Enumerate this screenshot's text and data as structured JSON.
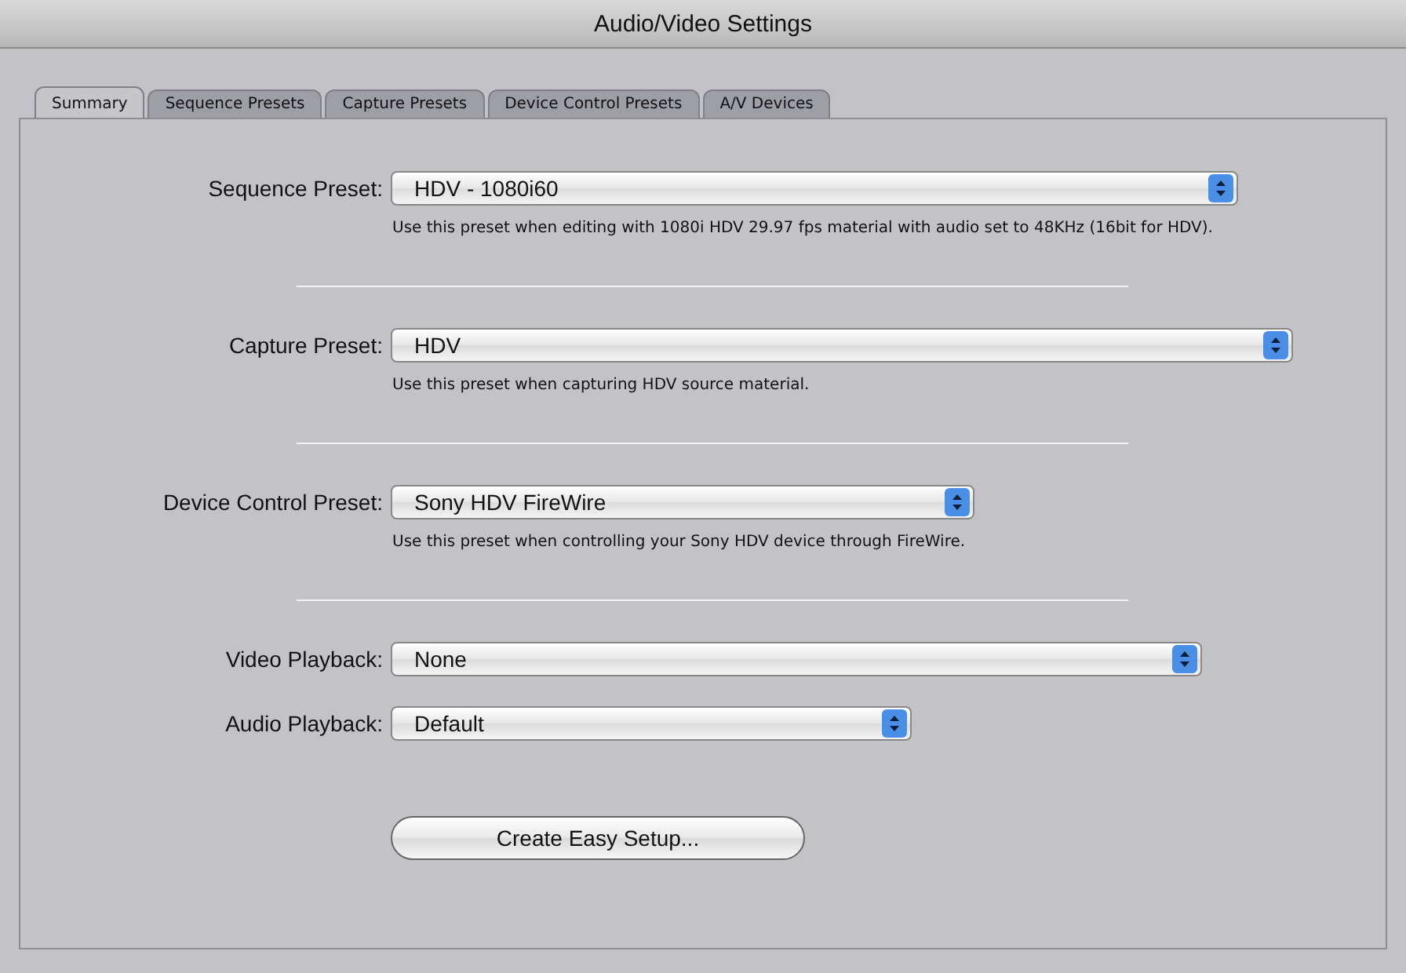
{
  "window": {
    "title": "Audio/Video Settings"
  },
  "tabs": [
    {
      "label": "Summary",
      "selected": true
    },
    {
      "label": "Sequence Presets",
      "selected": false
    },
    {
      "label": "Capture Presets",
      "selected": false
    },
    {
      "label": "Device Control Presets",
      "selected": false
    },
    {
      "label": "A/V Devices",
      "selected": false
    }
  ],
  "settings": [
    {
      "kind": "preset",
      "label": "Sequence Preset:",
      "value": "HDV - 1080i60",
      "description": "Use this preset when editing with 1080i HDV 29.97 fps material with audio set to 48KHz (16bit for HDV)."
    },
    {
      "kind": "preset",
      "label": "Capture Preset:",
      "value": "HDV",
      "description": "Use this preset when capturing HDV source material."
    },
    {
      "kind": "preset",
      "label": "Device Control Preset:",
      "value": "Sony HDV FireWire",
      "description": "Use this preset when controlling your Sony HDV device through FireWire."
    },
    {
      "kind": "plain",
      "label": "Video Playback:",
      "value": "None"
    },
    {
      "kind": "plain",
      "label": "Audio Playback:",
      "value": "Default"
    }
  ],
  "button": {
    "label": "Create Easy Setup..."
  }
}
